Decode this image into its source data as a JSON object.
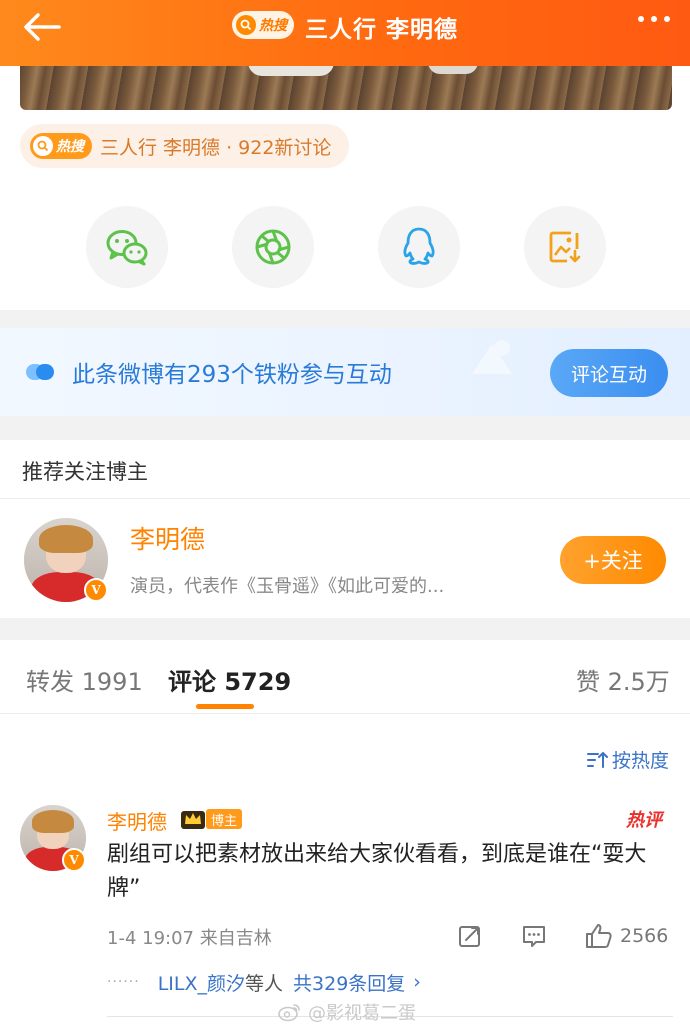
{
  "header": {
    "hot_label": "热搜",
    "title": "三人行 李明德"
  },
  "hot_topic": {
    "badge": "热搜",
    "text": "三人行 李明德 · 922新讨论"
  },
  "share": {
    "icons": [
      "wechat-icon",
      "moments-icon",
      "qq-icon",
      "save-image-icon"
    ]
  },
  "fans_banner": {
    "text": "此条微博有293个铁粉参与互动",
    "button": "评论互动"
  },
  "recommend": {
    "title": "推荐关注博主",
    "name": "李明德",
    "desc": "演员，代表作《玉骨遥》《如此可爱的...",
    "follow": "+关注",
    "verified": "V"
  },
  "tabs": {
    "repost_label": "转发",
    "repost_count": "1991",
    "comment_label": "评论",
    "comment_count": "5729",
    "like_label": "赞",
    "like_count": "2.5万"
  },
  "sort": {
    "label": "按热度"
  },
  "comment": {
    "user": "李明德",
    "badge": "博主",
    "hot_tag": "热评",
    "text": "剧组可以把素材放出来给大家伙看看，到底是谁在“耍大牌”",
    "time": "1-4 19:07",
    "location": "来自吉林",
    "likes": "2566",
    "reply_dots": "······",
    "reply_user": "LILX_颜汐",
    "reply_mid": "等人",
    "reply_count": "共329条回复",
    "reply_arrow": "›"
  },
  "watermark": {
    "text": "@影视葛二蛋"
  }
}
